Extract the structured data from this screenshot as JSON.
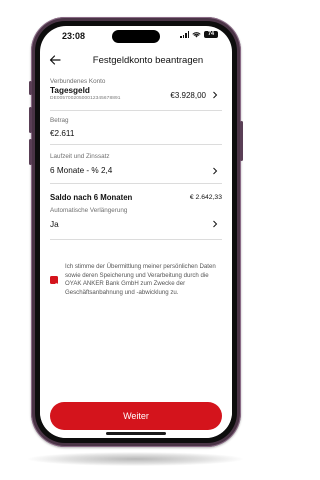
{
  "status_bar": {
    "time": "23:08",
    "battery": "74"
  },
  "header": {
    "title": "Festgeldkonto beantragen"
  },
  "connected_account": {
    "label": "Verbundenes Konto",
    "name": "Tagesgeld",
    "iban": "DE00570020500012345678891",
    "balance": "€3.928,00"
  },
  "amount": {
    "label": "Betrag",
    "value": "€2.611"
  },
  "term": {
    "label": "Laufzeit und Zinssatz",
    "value": "6 Monate - % 2,4"
  },
  "balance_after": {
    "label": "Saldo nach 6 Monaten",
    "value": "€ 2.642,33"
  },
  "auto_renewal": {
    "label": "Automatische Verlängerung",
    "value": "Ja"
  },
  "consent": {
    "checked": true,
    "text": "Ich stimme der Übermittlung meiner persönlichen Daten sowie deren Speicherung und Verarbeitung durch die OYAK ANKER Bank GmbH zum Zwecke der Geschäftsanbahnung und -abwicklung zu."
  },
  "cta": {
    "label": "Weiter"
  },
  "colors": {
    "accent": "#d4141c",
    "phone_frame": "#4a3446"
  },
  "icons": {
    "back": "arrow-left-icon",
    "row_chevron": "chevron-right-icon",
    "checkbox": "checkbox-checked-icon"
  }
}
